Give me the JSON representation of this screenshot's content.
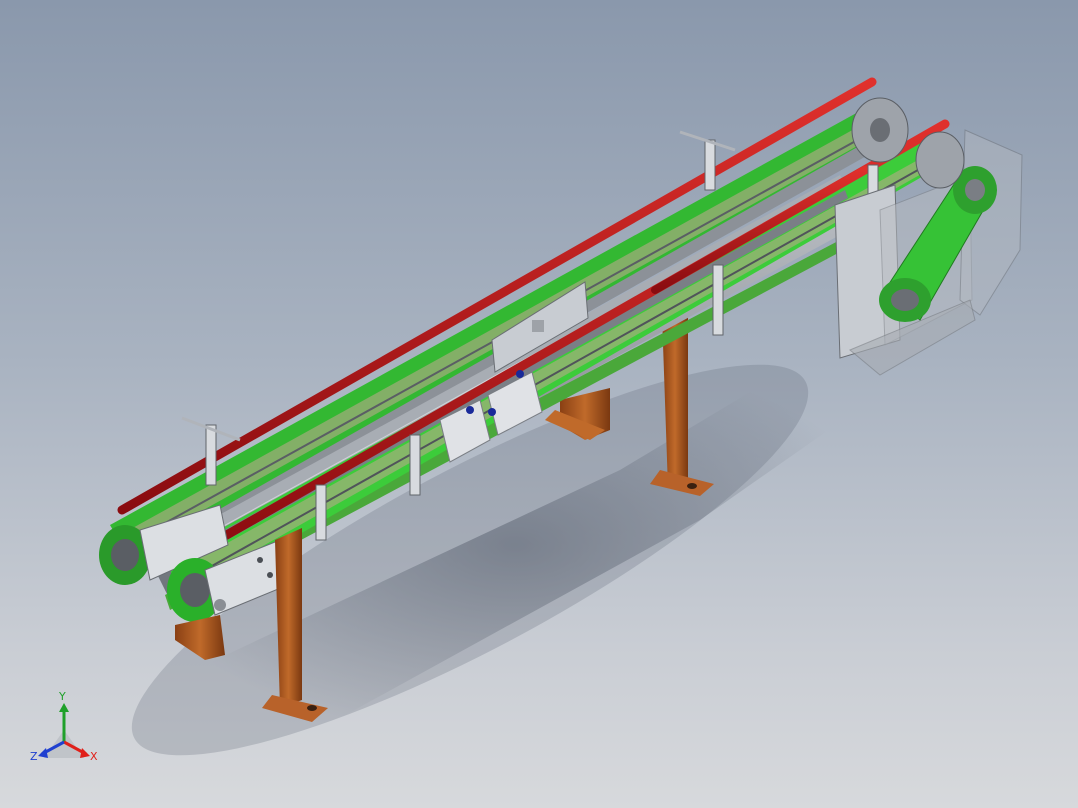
{
  "viewport": {
    "background_top": "#8a98ac",
    "background_bottom": "#d7d9dc"
  },
  "model": {
    "description_icon": "belt-conveyor-assembly-icon",
    "colors": {
      "guide_rail": "#c8141a",
      "belt": "#3cc83a",
      "frame": "#9aa0a8",
      "bracket": "#d9dce0",
      "leg": "#b25a1e",
      "motor_housing": "#c8ccd2"
    }
  },
  "triad": {
    "x_label": "X",
    "y_label": "Y",
    "z_label": "Z",
    "x_color": "#e0201a",
    "y_color": "#1fa02a",
    "z_color": "#2040d0"
  }
}
